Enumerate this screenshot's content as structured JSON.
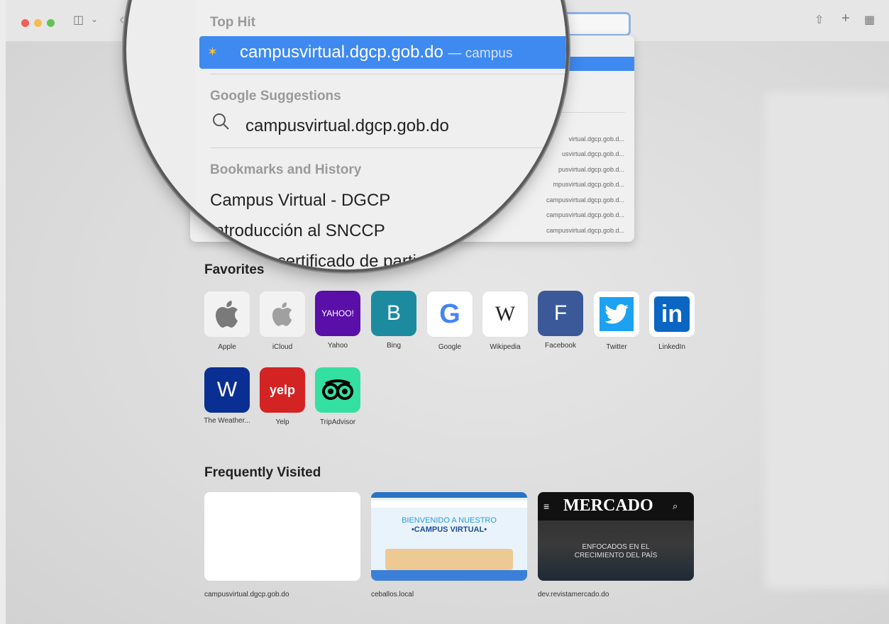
{
  "toolbar": {
    "share_glyph": "⇧",
    "plus_glyph": "+",
    "grid_glyph": "▦",
    "sidebar_glyph": "◫",
    "chevron_glyph": "⌄",
    "back_glyph": "‹"
  },
  "dropdown": {
    "top_hit_header": "Top Hit",
    "top_hit_url": "campusvirtual.dgcp.gob.do",
    "top_hit_sub": "— campus",
    "google_header": "Google Suggestions",
    "google_suggestion": "campusvirtual.dgcp.gob.do",
    "bookmarks_header": "Bookmarks and History",
    "items": [
      "Campus Virtual - DGCP",
      "Introducción al SNCCP",
      "Generar certificado de parti"
    ],
    "small_urls": [
      "virtual.dgcp.gob.d...",
      "usvirtual.dgcp.gob.d...",
      "pusvirtual.dgcp.gob.d...",
      "mpusvirtual.dgcp.gob.d...",
      "campusvirtual.dgcp.gob.d...",
      "campusvirtual.dgcp.gob.d...",
      "campusvirtual.dgcp.gob.d..."
    ]
  },
  "favorites": {
    "title": "Favorites",
    "items": [
      {
        "label": "Apple",
        "glyph": "",
        "color": "#f2f2f2",
        "fg": "#7a7a7a"
      },
      {
        "label": "iCloud",
        "glyph": "",
        "color": "#f2f2f2",
        "fg": "#9a9a9a"
      },
      {
        "label": "Yahoo",
        "glyph": "YAHOO!",
        "color": "#5a0fa8",
        "fg": "#ffffff"
      },
      {
        "label": "Bing",
        "glyph": "B",
        "color": "#1c8ba0",
        "fg": "#ffffff"
      },
      {
        "label": "Google",
        "glyph": "G",
        "color": "#ffffff",
        "fg": "#4285f4"
      },
      {
        "label": "Wikipedia",
        "glyph": "W",
        "color": "#ffffff",
        "fg": "#222222"
      },
      {
        "label": "Facebook",
        "glyph": "F",
        "color": "#3b5998",
        "fg": "#ffffff"
      },
      {
        "label": "Twitter",
        "glyph": "🐦",
        "color": "#ffffff",
        "fg": "#1da1f2"
      },
      {
        "label": "LinkedIn",
        "glyph": "in",
        "color": "#ffffff",
        "fg": "#0a66c2"
      },
      {
        "label": "The Weather...",
        "glyph": "W",
        "color": "#0a2f93",
        "fg": "#ffffff"
      },
      {
        "label": "Yelp",
        "glyph": "yelp",
        "color": "#d32323",
        "fg": "#ffffff"
      },
      {
        "label": "TripAdvisor",
        "glyph": "ꝏ",
        "color": "#34e0a1",
        "fg": "#000000"
      }
    ]
  },
  "frequently_visited": {
    "title": "Frequently Visited",
    "items": [
      {
        "label": "campusvirtual.dgcp.gob.do"
      },
      {
        "label": "ceballos.local",
        "thumb_title_1": "BIENVENIDO A NUESTRO",
        "thumb_title_2": "•CAMPUS VIRTUAL•"
      },
      {
        "label": "dev.revistamercado.do",
        "thumb_title": "MERCADO",
        "thumb_line1": "ENFOCADOS EN EL",
        "thumb_line2": "CRECIMIENTO DEL PAÍS"
      }
    ]
  }
}
